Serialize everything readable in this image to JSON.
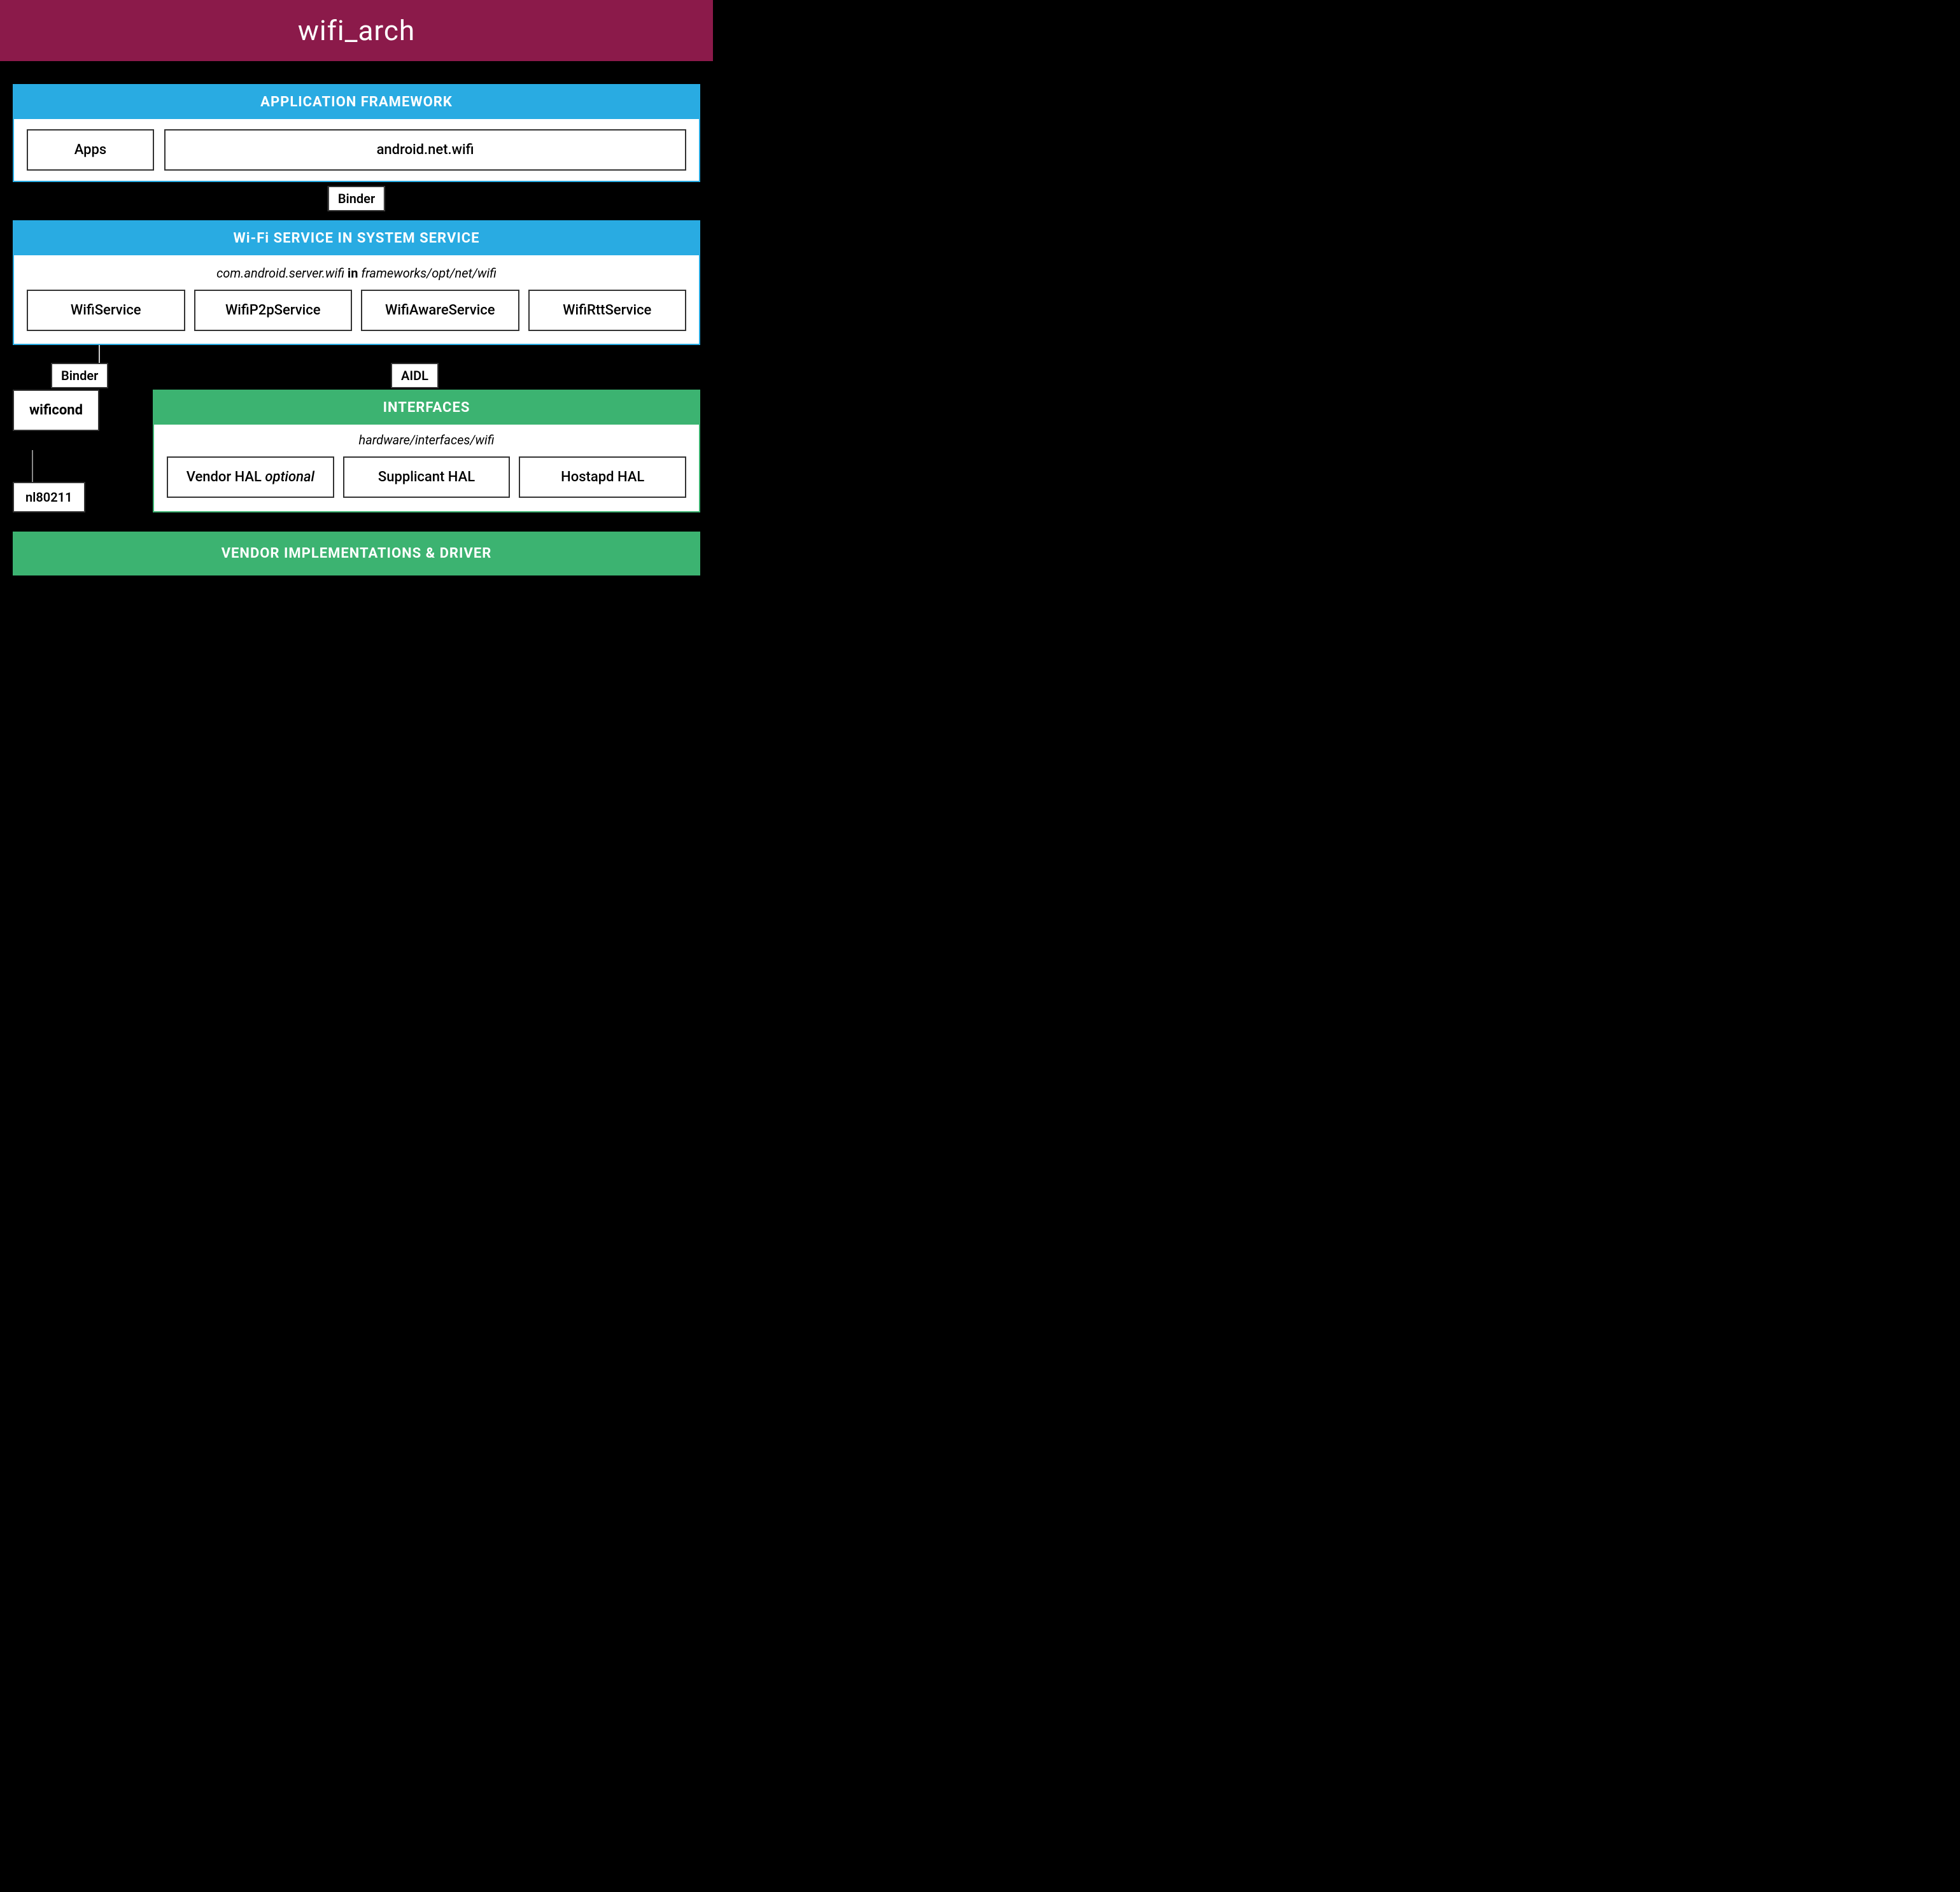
{
  "title": "wifi_arch",
  "app_framework": {
    "header": "APPLICATION FRAMEWORK",
    "apps_label": "Apps",
    "android_net_wifi_label": "android.net.wifi"
  },
  "binder_top": "Binder",
  "wifi_service": {
    "header": "Wi-Fi SERVICE IN SYSTEM SERVICE",
    "subpath_italic": "com.android.server.wifi",
    "subpath_bold": "in",
    "subpath_italic2": "frameworks/opt/net/wifi",
    "services": [
      "WifiService",
      "WifiP2pService",
      "WifiAwareService",
      "WifiRttService"
    ]
  },
  "binder_left": "Binder",
  "aidl_label": "AIDL",
  "wificond_label": "wificond",
  "nl80211_label": "nl80211",
  "interfaces": {
    "header": "INTERFACES",
    "subpath": "hardware/interfaces/wifi",
    "hal_items": [
      "Vendor HAL (optional)",
      "Supplicant HAL",
      "Hostapd HAL"
    ]
  },
  "vendor": {
    "header": "VENDOR IMPLEMENTATIONS & DRIVER"
  }
}
